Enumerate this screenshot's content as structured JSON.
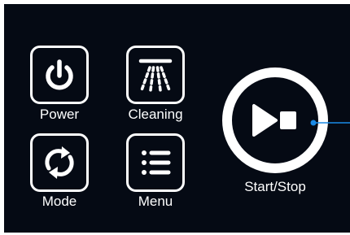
{
  "controls": {
    "power": {
      "label": "Power",
      "icon": "power-icon"
    },
    "cleaning": {
      "label": "Cleaning",
      "icon": "shower-spray-icon"
    },
    "mode": {
      "label": "Mode",
      "icon": "cycle-arrows-icon"
    },
    "menu": {
      "label": "Menu",
      "icon": "list-icon"
    },
    "start_stop": {
      "label": "Start/Stop",
      "icon": "play-stop-icon"
    }
  },
  "colors": {
    "panel_background": "#050a14",
    "foreground": "#ffffff",
    "callout": "#1a8ae6"
  }
}
